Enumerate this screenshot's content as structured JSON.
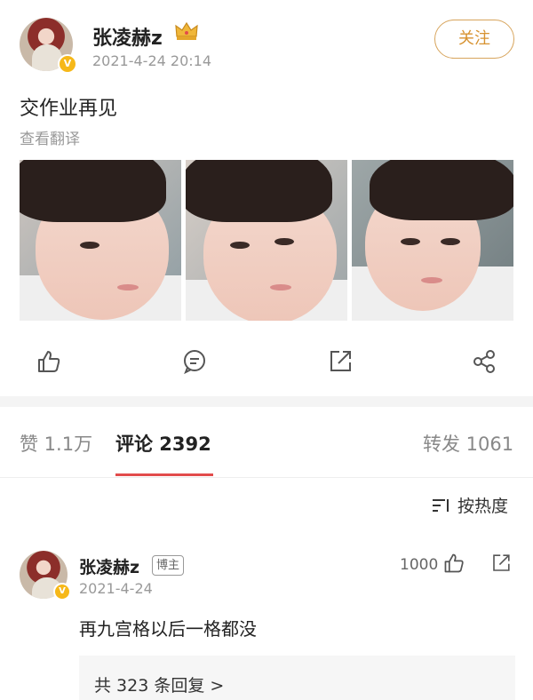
{
  "post": {
    "author": "张凌赫z",
    "verified_badge": "V",
    "crown_icon": "crown-icon",
    "timestamp": "2021-4-24 20:14",
    "follow_label": "关注",
    "text": "交作业再见",
    "translate_label": "查看翻译",
    "photos": [
      "photo-1",
      "photo-2",
      "photo-3"
    ]
  },
  "actions": {
    "like_icon": "thumbs-up-icon",
    "comment_icon": "comment-icon",
    "share_icon": "repost-icon",
    "more_icon": "share-icon"
  },
  "tabs": {
    "likes_label": "赞 1.1万",
    "comments_label": "评论 2392",
    "reposts_label": "转发 1061"
  },
  "sort": {
    "label": "按热度"
  },
  "comment": {
    "author": "张凌赫z",
    "op_badge": "博主",
    "date": "2021-4-24",
    "text": "再九宫格以后一格都没",
    "likes": "1000",
    "replies_label": "共 323 条回复 >"
  },
  "colors": {
    "accent": "#e24c4c",
    "follow": "#d79230",
    "muted": "#999999"
  }
}
